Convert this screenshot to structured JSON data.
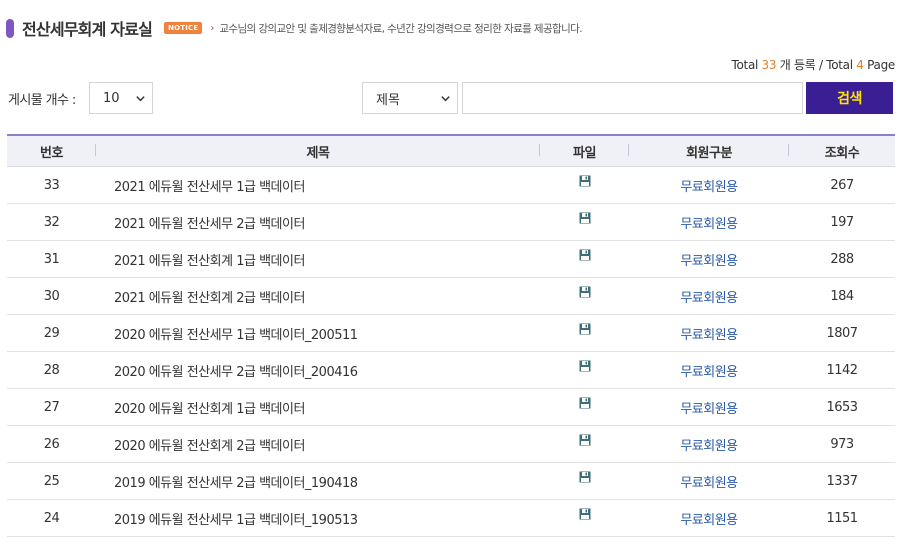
{
  "header": {
    "title": "전산세무회계 자료실",
    "notice_badge": "NOTICE",
    "notice_arrow": "›",
    "notice_text": "교수님의 강의교안 및 출제경향분석자료, 수년간 강의경력으로 정리한 자료를 제공합니다."
  },
  "total": {
    "prefix": "Total ",
    "count": "33",
    "middle": " 개 등록 / Total ",
    "pages": "4",
    "suffix": " Page"
  },
  "controls": {
    "count_label": "게시물 개수 :",
    "count_value": "10",
    "field_value": "제목",
    "search_value": "",
    "search_button": "검색"
  },
  "table": {
    "columns": [
      "번호",
      "제목",
      "파일",
      "회원구분",
      "조회수"
    ],
    "rows": [
      {
        "no": "33",
        "title": "2021 에듀윌 전산세무 1급 백데이터",
        "member": "무료회원용",
        "views": "267"
      },
      {
        "no": "32",
        "title": "2021 에듀윌 전산세무 2급 백데이터",
        "member": "무료회원용",
        "views": "197"
      },
      {
        "no": "31",
        "title": "2021 에듀윌 전산회계 1급 백데이터",
        "member": "무료회원용",
        "views": "288"
      },
      {
        "no": "30",
        "title": "2021 에듀윌 전산회계 2급 백데이터",
        "member": "무료회원용",
        "views": "184"
      },
      {
        "no": "29",
        "title": "2020 에듀윌 전산세무 1급 백데이터_200511",
        "member": "무료회원용",
        "views": "1807"
      },
      {
        "no": "28",
        "title": "2020 에듀윌 전산세무 2급 백데이터_200416",
        "member": "무료회원용",
        "views": "1142"
      },
      {
        "no": "27",
        "title": "2020 에듀윌 전산회계 1급 백데이터",
        "member": "무료회원용",
        "views": "1653"
      },
      {
        "no": "26",
        "title": "2020 에듀윌 전산회계 2급 백데이터",
        "member": "무료회원용",
        "views": "973"
      },
      {
        "no": "25",
        "title": "2019 에듀윌 전산세무 2급 백데이터_190418",
        "member": "무료회원용",
        "views": "1337"
      },
      {
        "no": "24",
        "title": "2019 에듀윌 전산세무 1급 백데이터_190513",
        "member": "무료회원용",
        "views": "1151"
      }
    ]
  },
  "icons": {
    "file": "floppy-disk-icon",
    "dropdown": "chevron-down-icon"
  },
  "colors": {
    "accent_purple": "#7e57c2",
    "search_button_bg": "#3a1e93",
    "search_button_text": "#ffe400",
    "notice_orange": "#f0823c",
    "highlight_number": "#e0802b",
    "link_blue": "#2a5aa8"
  }
}
